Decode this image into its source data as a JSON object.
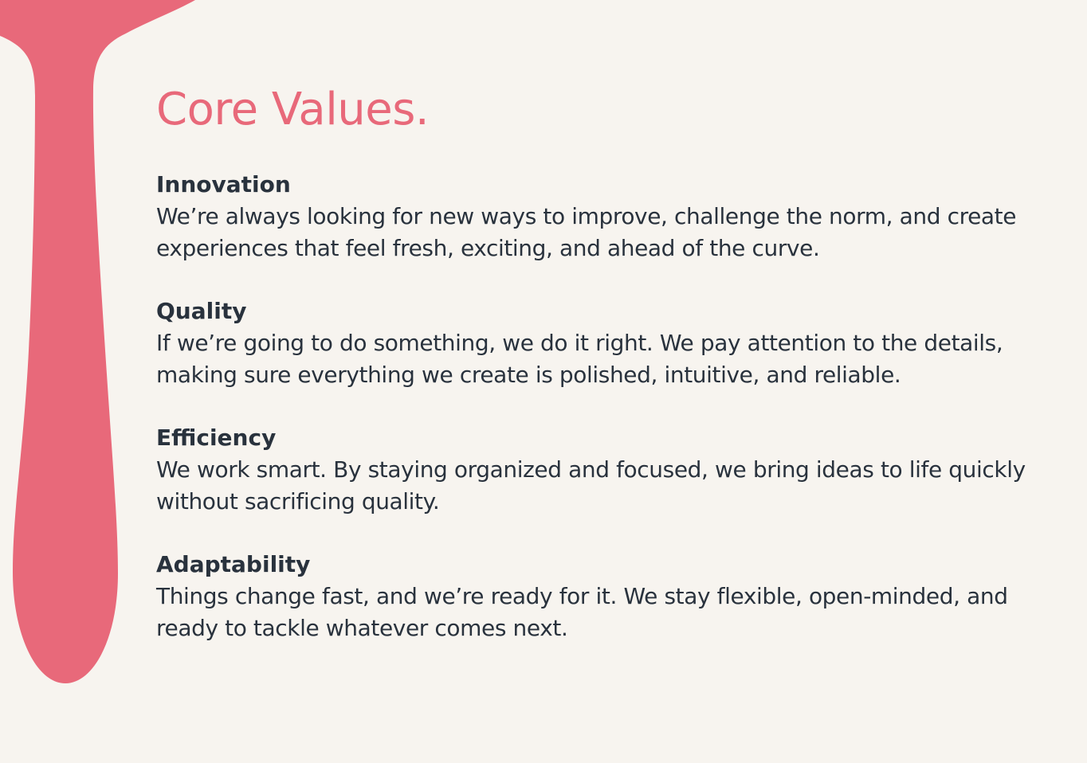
{
  "colors": {
    "background": "#f7f4ef",
    "accent": "#e8697a",
    "text": "#29323d"
  },
  "page": {
    "title": "Core Values."
  },
  "values": [
    {
      "heading": "Innovation",
      "text": "We’re always looking for new ways to improve, challenge the norm, and create experiences that feel fresh, exciting, and ahead of the curve."
    },
    {
      "heading": "Quality",
      "text": "If we’re going to do something, we do it right. We pay attention to the details, making sure everything we create is polished, intuitive, and reliable."
    },
    {
      "heading": "Efficiency",
      "text": "We work smart. By staying organized and focused, we bring ideas to life quickly without sacrificing quality."
    },
    {
      "heading": "Adaptability",
      "text": "Things change fast, and we’re ready for it. We stay flexible, open-minded, and ready to tackle whatever comes next."
    }
  ]
}
